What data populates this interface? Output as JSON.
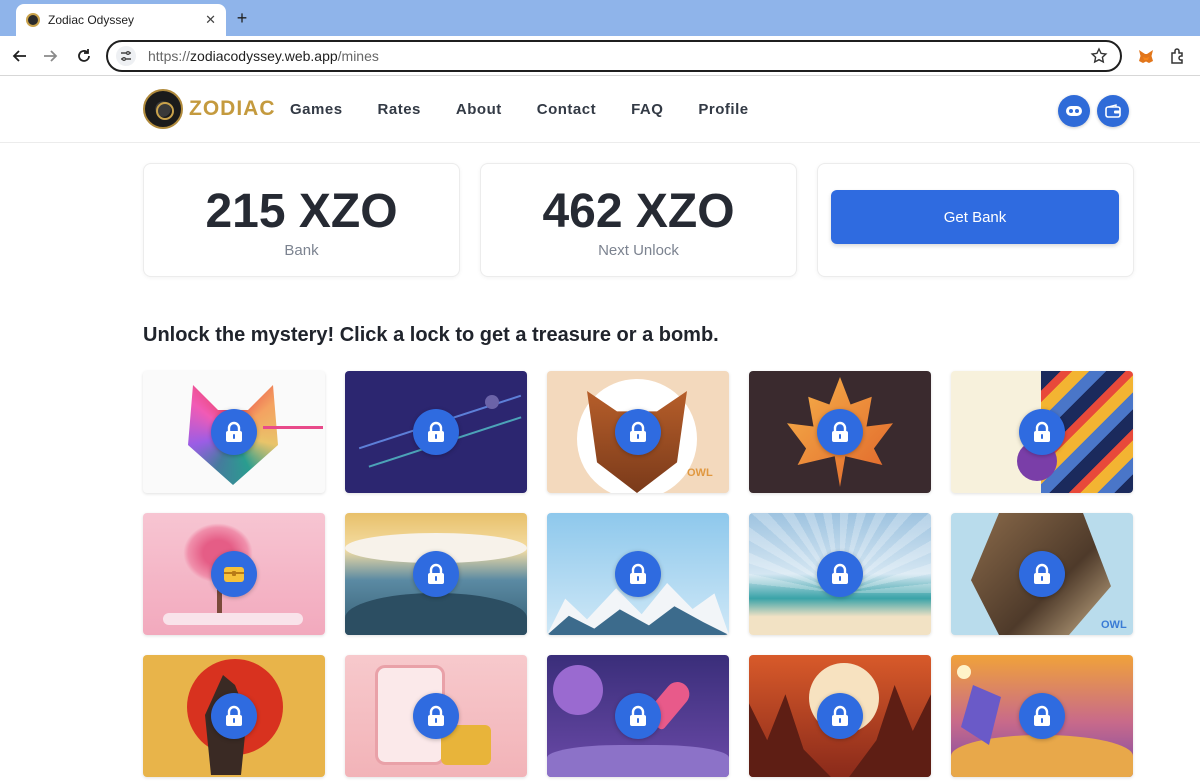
{
  "browser": {
    "tab_title": "Zodiac Odyssey",
    "url_prefix": "https://",
    "url_host": "zodiacodyssey.web.app",
    "url_path": "/mines"
  },
  "site": {
    "logo_text": "ZODIAC",
    "nav": [
      "Games",
      "Rates",
      "About",
      "Contact",
      "FAQ",
      "Profile"
    ]
  },
  "stats": {
    "bank_amount": "215 XZO",
    "bank_label": "Bank",
    "next_amount": "462 XZO",
    "next_label": "Next Unlock",
    "get_bank_label": "Get Bank"
  },
  "headline": "Unlock the mystery! Click a lock to get a treasure or a bomb.",
  "tiles": [
    {
      "state": "locked",
      "art": "colorful cat"
    },
    {
      "state": "locked",
      "art": "navy lines"
    },
    {
      "state": "locked",
      "art": "owl",
      "caption": "OWL"
    },
    {
      "state": "locked",
      "art": "maple leaf"
    },
    {
      "state": "locked",
      "art": "geometric shapes"
    },
    {
      "state": "treasure",
      "art": "pink tree"
    },
    {
      "state": "locked",
      "art": "sea waves"
    },
    {
      "state": "locked",
      "art": "businessman mountains"
    },
    {
      "state": "locked",
      "art": "beach"
    },
    {
      "state": "locked",
      "art": "owl closeup",
      "caption": "OWL"
    },
    {
      "state": "locked",
      "art": "red sun beast"
    },
    {
      "state": "locked",
      "art": "online store"
    },
    {
      "state": "locked",
      "art": "space rocket"
    },
    {
      "state": "locked",
      "art": "canyon"
    },
    {
      "state": "locked",
      "art": "desert"
    }
  ],
  "colors": {
    "accent": "#2f6be0",
    "brand_gold": "#c49a3e",
    "chrome_blue": "#8fb4ea"
  }
}
